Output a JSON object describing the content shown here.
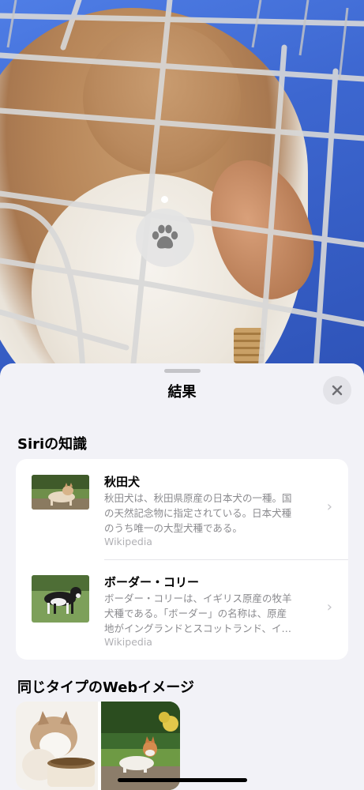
{
  "photo": {
    "subject_icon": "paw-icon"
  },
  "sheet": {
    "title": "結果",
    "close_icon": "close-icon"
  },
  "siri_knowledge": {
    "heading": "Siriの知識",
    "items": [
      {
        "name": "秋田犬",
        "desc_line1": "秋田犬は、秋田県原産の日本犬の一種。国",
        "desc_line2": "の天然記念物に指定されている。日本犬種",
        "desc_line3": "のうち唯一の大型犬種である。",
        "source": "Wikipedia",
        "thumb_icon": "akita-dog-photo"
      },
      {
        "name": "ボーダー・コリー",
        "desc_line1": "ボーダー・コリーは、イギリス原産の牧羊",
        "desc_line2": "犬種である。「ボーダー」の名称は、原産",
        "desc_line3": "地がイングランドとスコットランド、イ…",
        "source": "Wikipedia",
        "thumb_icon": "border-collie-photo"
      }
    ]
  },
  "web_images": {
    "heading": "同じタイプのWebイメージ",
    "items": [
      "husky-puppy-photo",
      "shiba-dog-photo"
    ]
  }
}
